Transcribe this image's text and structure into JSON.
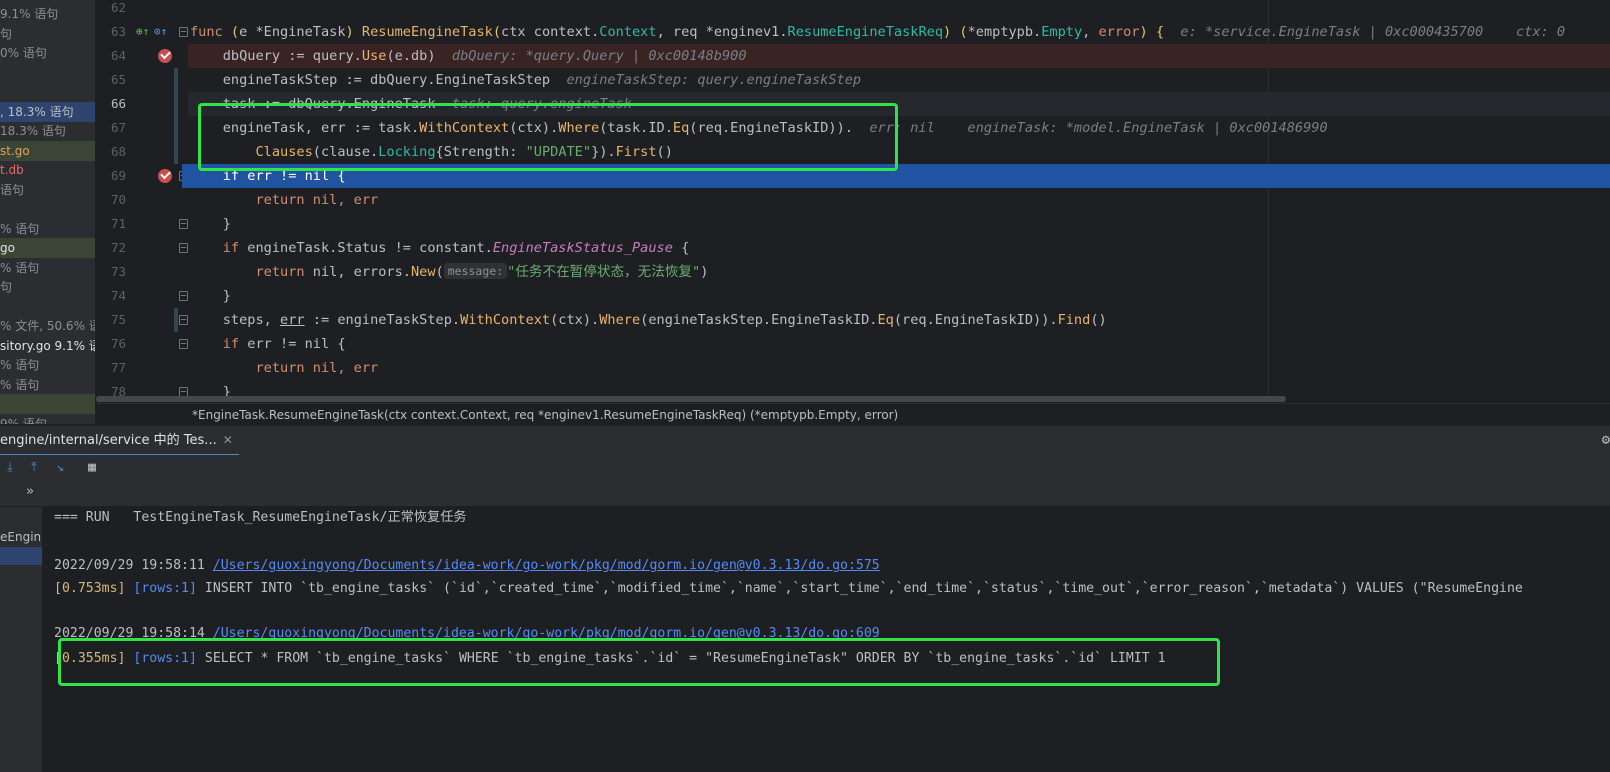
{
  "project_tree": {
    "items": [
      {
        "text": "9.1% 语句",
        "color": "#8c8f95"
      },
      {
        "text": "句",
        "color": "#8c8f95"
      },
      {
        "text": "0% 语句",
        "color": "#8c8f95"
      },
      {
        "text": "",
        "color": "#8c8f95"
      },
      {
        "text": "",
        "color": "#8c8f95"
      },
      {
        "text": ", 18.3% 语句",
        "color": "#bcbec4"
      },
      {
        "text": " 18.3% 语句",
        "color": "#8c8f95"
      },
      {
        "text": "st.go",
        "color": "#e0a25a"
      },
      {
        "text": "t.db",
        "color": "#e06c6c"
      },
      {
        "text": "语句",
        "color": "#8c8f95"
      },
      {
        "text": "",
        "color": "#8c8f95"
      },
      {
        "text": "% 语句",
        "color": "#8c8f95"
      },
      {
        "text": "go",
        "color": "#dfe1e5"
      },
      {
        "text": "% 语句",
        "color": "#8c8f95"
      },
      {
        "text": "句",
        "color": "#8c8f95"
      },
      {
        "text": "",
        "color": "#8c8f95"
      },
      {
        "text": "% 文件, 50.6% 语",
        "color": "#8c8f95"
      },
      {
        "text": "sitory.go  9.1% 语",
        "color": "#dfe1e5"
      },
      {
        "text": "% 语句",
        "color": "#8c8f95"
      },
      {
        "text": "% 语句",
        "color": "#8c8f95"
      },
      {
        "text": "",
        "color": "#8c8f95"
      },
      {
        "text": "9% 语句",
        "color": "#8c8f95"
      }
    ]
  },
  "editor": {
    "line_numbers": [
      "62",
      "63",
      "64",
      "65",
      "66",
      "67",
      "68",
      "69",
      "70",
      "71",
      "72",
      "73",
      "74",
      "75",
      "76",
      "77",
      "78"
    ],
    "line63": {
      "func": "func ",
      "recv_open": "(",
      "recv": "e ",
      "recv_type": "*EngineTask",
      "recv_close": ") ",
      "name": "ResumeEngineTask",
      "params_open": "(",
      "p1": "ctx ",
      "p1_pkg": "context.",
      "p1_type": "Context",
      "p2": ", req ",
      "p2_pkg": "*enginev1.",
      "p2_type": "ResumeEngineTaskReq",
      "params_close": ") ",
      "ret_open": "(",
      "ret1_pkg": "*emptypb.",
      "ret1_type": "Empty",
      "comma": ", ",
      "ret2": "error",
      "ret_close": ") {",
      "hint": "  e: *service.EngineTask | 0xc000435700    ctx: 0"
    },
    "line64": {
      "a": "    dbQuery := ",
      "pkg": "query.",
      "fn": "Use",
      "b": "(e.db)",
      "hint": "  dbQuery: *query.Query | 0xc00148b900"
    },
    "line65": {
      "a": "    engineTaskStep := dbQuery.EngineTaskStep",
      "hint": "  engineTaskStep: query.engineTaskStep"
    },
    "line66": {
      "a": "    task := dbQuery.EngineTask",
      "hint": "  task: query.engineTask"
    },
    "line67": {
      "a": "    engineTask, err := task.",
      "fn1": "WithContext",
      "b": "(ctx).",
      "fn2": "Where",
      "c": "(task.ID.",
      "fn3": "Eq",
      "d": "(req.EngineTaskID)).",
      "hint": "  err: nil    engineTask: *model.EngineTask | 0xc001486990"
    },
    "line68": {
      "fn1": "        Clauses",
      "a": "(clause.",
      "ty": "Locking",
      "b": "{Strength: ",
      "str": "\"UPDATE\"",
      "c": "}).",
      "fn2": "First",
      "d": "()"
    },
    "line69": {
      "text": "    if err != nil {"
    },
    "line70": {
      "kw": "        return ",
      "a": "nil, err"
    },
    "line71": {
      "a": "    }"
    },
    "line72": {
      "kw": "    if ",
      "a": "engineTask.Status != constant.",
      "cst": "EngineTaskStatus_Pause",
      "b": " {"
    },
    "line73": {
      "kw": "        return ",
      "a": "nil, errors.",
      "fn": "New",
      "b": "(",
      "pill": "message:",
      "str": "\"任务不在暂停状态，无法恢复\"",
      "c": ")"
    },
    "line74": {
      "a": "    }"
    },
    "line75": {
      "a": "    steps, ",
      "err": "err",
      "b": " := engineTaskStep.",
      "fn1": "WithContext",
      "c": "(ctx).",
      "fn2": "Where",
      "d": "(engineTaskStep.EngineTaskID.",
      "fn3": "Eq",
      "e": "(req.EngineTaskID)).",
      "fn4": "Find",
      "f": "()"
    },
    "line76": {
      "kw": "    if ",
      "a": "err != nil {"
    },
    "line77": {
      "kw": "        return ",
      "a": "nil, err"
    },
    "line78": {
      "a": "    }"
    }
  },
  "breadcrumb": {
    "text": "*EngineTask.ResumeEngineTask(ctx context.Context, req *enginev1.ResumeEngineTaskReq) (*emptypb.Empty, error)"
  },
  "run_window": {
    "tab_label": "engine/internal/service 中的 Tes...",
    "close_glyph": "✕",
    "toolbar": {
      "more": "»"
    },
    "test_item": "eEngin"
  },
  "console": {
    "run_line": "=== RUN   TestEngineTask_ResumeEngineTask/正常恢复任务",
    "log1": {
      "time": "2022/09/29 19:58:11 ",
      "path": "/Users/guoxingyong/Documents/idea-work/go-work/pkg/mod/gorm.io/gen@v0.3.13/do.go:575"
    },
    "sql1": {
      "ms": "[0.753ms] ",
      "rows": "[rows:1] ",
      "sql": "INSERT INTO `tb_engine_tasks` (`id`,`created_time`,`modified_time`,`name`,`start_time`,`end_time`,`status`,`time_out`,`error_reason`,`metadata`) VALUES (\"ResumeEngine"
    },
    "log2": {
      "time": "2022/09/29 19:58:14 ",
      "path": "/Users/guoxingyong/Documents/idea-work/go-work/pkg/mod/gorm.io/gen@v0.3.13/do.go:609"
    },
    "sql2": {
      "ms": "[0.355ms] ",
      "rows": "[rows:1] ",
      "sql": "SELECT * FROM `tb_engine_tasks` WHERE `tb_engine_tasks`.`id` = \"ResumeEngineTask\" ORDER BY `tb_engine_tasks`.`id` LIMIT 1"
    }
  },
  "colors": {
    "annotation": "#2fe34a",
    "exec_line": "#2154a0",
    "breakpoint": "#c94f4f"
  }
}
